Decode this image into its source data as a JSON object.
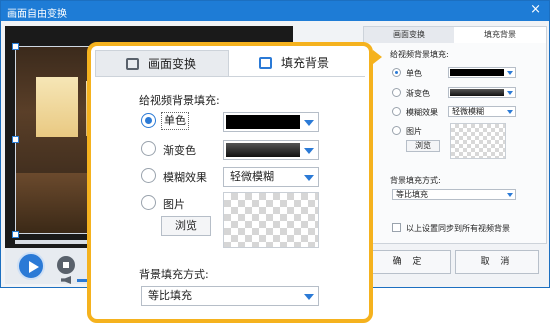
{
  "window": {
    "title": "画面自由变换"
  },
  "tabs": [
    {
      "label": "画面变换",
      "icon": "transform-icon"
    },
    {
      "label": "填充背景",
      "icon": "fill-background-icon"
    }
  ],
  "fill": {
    "heading": "给视频背景填充:",
    "options": [
      {
        "label": "单色",
        "selected": true
      },
      {
        "label": "渐变色",
        "selected": false
      },
      {
        "label": "模糊效果",
        "selected": false
      },
      {
        "label": "图片",
        "selected": false
      }
    ],
    "solid_color": "#000000",
    "blur_value": "轻微模糊",
    "browse_label": "浏览"
  },
  "mode": {
    "label": "背景填充方式:",
    "value": "等比填充"
  },
  "sync": {
    "label": "以上设置同步到所有视频背景",
    "checked": false
  },
  "buttons": {
    "ok": "确 定",
    "cancel": "取 消"
  },
  "colors": {
    "accent": "#1e7cd6",
    "highlight": "#f5b21e"
  }
}
